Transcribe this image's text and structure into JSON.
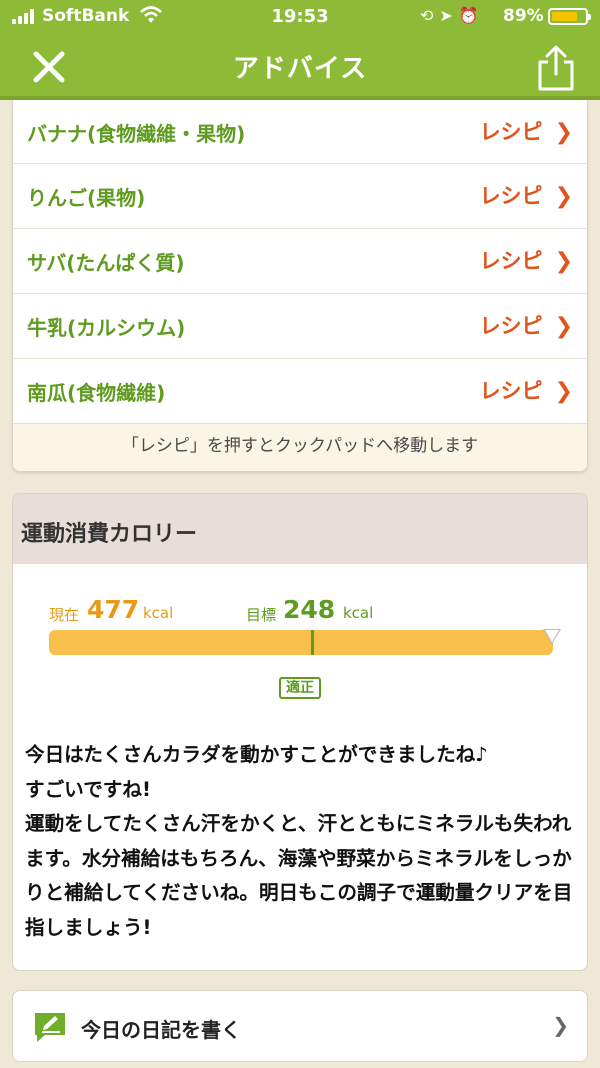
{
  "status_bar": {
    "carrier": "SoftBank",
    "time": "19:53",
    "battery_percent": "89%",
    "icons": [
      "signal-icon",
      "wifi-icon",
      "orientation-lock-icon",
      "location-icon",
      "alarm-icon",
      "battery-icon"
    ]
  },
  "nav": {
    "title": "アドバイス",
    "close_icon": "close-icon",
    "share_icon": "share-icon"
  },
  "recipes": {
    "link_label": "レシピ",
    "items": [
      {
        "food": "バナナ(食物繊維・果物)"
      },
      {
        "food": "りんご(果物)"
      },
      {
        "food": "サバ(たんぱく質)"
      },
      {
        "food": "牛乳(カルシウム)"
      },
      {
        "food": "南瓜(食物繊維)"
      }
    ],
    "note": "「レシピ」を押すとクックパッドへ移動します"
  },
  "exercise": {
    "title": "運動消費カロリー",
    "current_label": "現在",
    "current_value": "477",
    "target_label": "目標",
    "target_value": "248",
    "unit": "kcal",
    "status": "適正",
    "message": "今日はたくさんカラダを動かすことができましたね♪\nすごいですね!\n運動をしてたくさん汗をかくと、汗とともにミネラルも失われます。水分補給はもちろん、海藻や野菜からミネラルをしっかりと補給してくださいね。明日もこの調子で運動量クリアを目指しましょう!"
  },
  "diary": {
    "label": "今日の日記を書く",
    "icon": "pencil-note-icon"
  },
  "colors": {
    "header_green": "#8dbb37",
    "food_green": "#5e9b1e",
    "recipe_orange": "#e2541a",
    "bar_yellow": "#f8c04a",
    "current_orange": "#e89a16"
  }
}
